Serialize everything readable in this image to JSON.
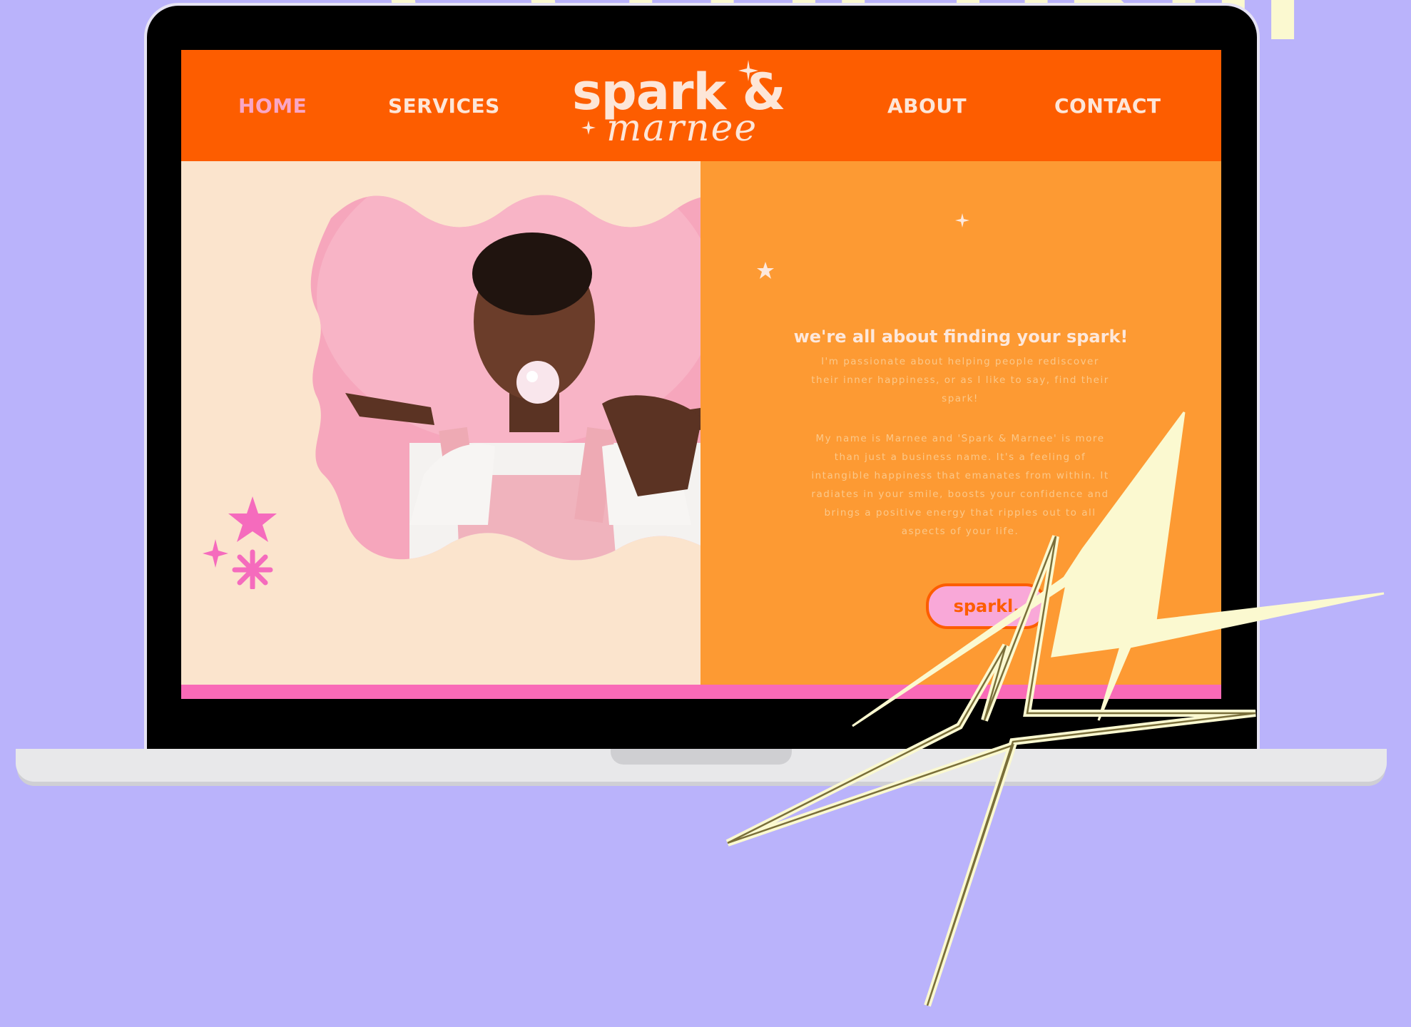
{
  "banner": {
    "text": "C CLLIJ TIKIJI"
  },
  "site": {
    "logo": {
      "top": "spark &",
      "bottom": "marnee"
    },
    "nav": [
      {
        "label": "HOME",
        "active": true
      },
      {
        "label": "SERVICES",
        "active": false
      },
      {
        "label": "ABOUT",
        "active": false
      },
      {
        "label": "CONTACT",
        "active": false
      }
    ],
    "hero": {
      "headline": "we're all about finding your spark!",
      "paragraph_1": "I'm passionate about helping people rediscover their inner happiness, or as I like to say, find their spark!",
      "paragraph_2": "My name is Marnee and 'Spark & Marnee' is more than just a business name. It's a feeling of intangible happiness that emanates from within. It radiates in your smile, boosts your confidence and brings a positive energy that ripples out to all aspects of your life.",
      "cta_label": "sparkl."
    }
  },
  "colors": {
    "background": "#bab3fb",
    "nav_orange": "#fd5d00",
    "hero_right": "#fd9a33",
    "hero_left": "#fbe4cd",
    "pink_accent": "#f96ab7",
    "spark_yellow": "#fbf9d0"
  },
  "icons": [
    "sparkle-icon",
    "star-icon",
    "asterisk-icon",
    "lightning-spark-icon"
  ]
}
